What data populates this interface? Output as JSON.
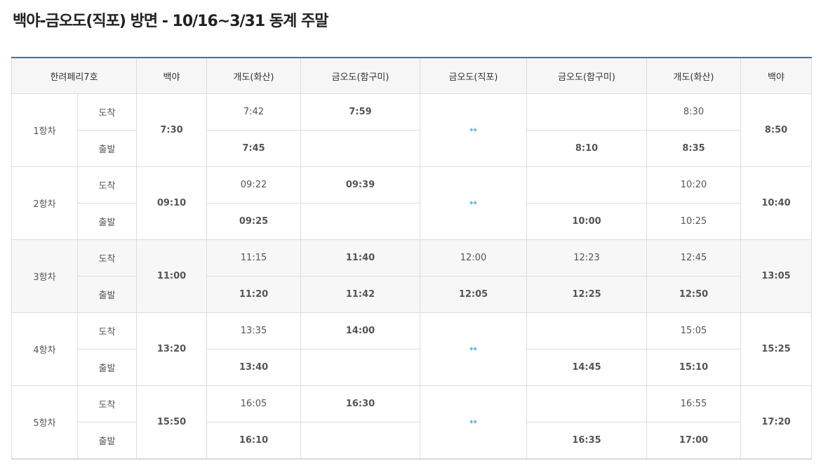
{
  "title": "백야-금오도(직포) 방면 - 10/16~3/31 동계 주말",
  "headers": {
    "ferry": "한려페리7호",
    "baekya1": "백야",
    "gaedo1": "개도(화산)",
    "hamgumi1": "금오도(함구미)",
    "jikpo": "금오도(직포)",
    "hamgumi2": "금오도(함구미)",
    "gaedo2": "개도(화산)",
    "baekya2": "백야"
  },
  "labels": {
    "arrive": "도착",
    "depart": "출발",
    "arrow": "↔"
  },
  "trips": [
    {
      "name": "1항차",
      "baekya_dep": "7:30",
      "gaedo1_arr": "7:42",
      "gaedo1_dep": "7:45",
      "hamgumi1_arr": "7:59",
      "hamgumi1_dep": "",
      "jikpo_arr": "",
      "jikpo_dep": "",
      "hamgumi2_arr": "",
      "hamgumi2_dep": "8:10",
      "gaedo2_arr": "8:30",
      "gaedo2_dep": "8:35",
      "baekya_arr": "8:50"
    },
    {
      "name": "2항차",
      "baekya_dep": "09:10",
      "gaedo1_arr": "09:22",
      "gaedo1_dep": "09:25",
      "hamgumi1_arr": "09:39",
      "hamgumi1_dep": "",
      "jikpo_arr": "",
      "jikpo_dep": "",
      "hamgumi2_arr": "",
      "hamgumi2_dep": "10:00",
      "gaedo2_arr": "10:20",
      "gaedo2_dep": "10:25",
      "baekya_arr": "10:40"
    },
    {
      "name": "3항차",
      "baekya_dep": "11:00",
      "gaedo1_arr": "11:15",
      "gaedo1_dep": "11:20",
      "hamgumi1_arr": "11:40",
      "hamgumi1_dep": "11:42",
      "jikpo_arr": "12:00",
      "jikpo_dep": "12:05",
      "hamgumi2_arr": "12:23",
      "hamgumi2_dep": "12:25",
      "gaedo2_arr": "12:45",
      "gaedo2_dep": "12:50",
      "baekya_arr": "13:05"
    },
    {
      "name": "4항차",
      "baekya_dep": "13:20",
      "gaedo1_arr": "13:35",
      "gaedo1_dep": "13:40",
      "hamgumi1_arr": "14:00",
      "hamgumi1_dep": "",
      "jikpo_arr": "",
      "jikpo_dep": "",
      "hamgumi2_arr": "",
      "hamgumi2_dep": "14:45",
      "gaedo2_arr": "15:05",
      "gaedo2_dep": "15:10",
      "baekya_arr": "15:25"
    },
    {
      "name": "5항차",
      "baekya_dep": "15:50",
      "gaedo1_arr": "16:05",
      "gaedo1_dep": "16:10",
      "hamgumi1_arr": "16:30",
      "hamgumi1_dep": "",
      "jikpo_arr": "",
      "jikpo_dep": "",
      "hamgumi2_arr": "",
      "hamgumi2_dep": "16:35",
      "gaedo2_arr": "16:55",
      "gaedo2_dep": "17:00",
      "baekya_arr": "17:20"
    }
  ]
}
